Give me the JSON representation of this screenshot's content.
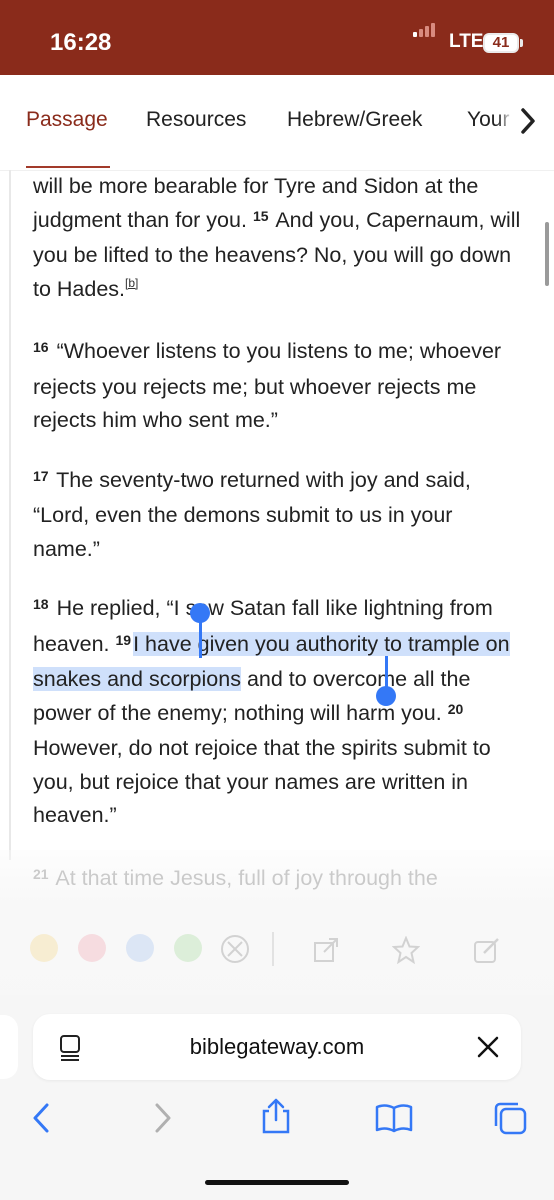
{
  "status": {
    "time": "16:28",
    "network": "LTE",
    "battery": "41"
  },
  "tabs": [
    {
      "label": "Passage",
      "active": true
    },
    {
      "label": "Resources"
    },
    {
      "label": "Hebrew/Greek"
    },
    {
      "label": "Your"
    }
  ],
  "passage": {
    "p1_text": "will be more bearable for Tyre and Sidon at the judgment than for you.",
    "v15": "15",
    "p1_text2": "And you, Capernaum, will you be lifted to the heavens? No, you will go down to Hades.",
    "fn_b": "[b]",
    "v16": "16",
    "p2_text": "“Whoever listens to you listens to me; whoever rejects you rejects me; but whoever rejects me rejects him who sent me.”",
    "v17": "17",
    "p3_text": "The seventy-two returned with joy and said, “Lord, even the demons submit to us in your name.”",
    "v18": "18",
    "p4_a": "He replied, “I saw Satan fall like lightning from heaven.",
    "v19": "19",
    "p4_sel": "I have given you authority to trample on snakes and scorpions",
    "p4_b": "and to overcome all the power of the enemy; nothing will harm you.",
    "v20": "20",
    "p4_c": "However, do not rejoice that the spirits submit to you, but rejoice that your names are written in heaven.”",
    "v21": "21",
    "p5_text": "At that time Jesus, full of joy through the"
  },
  "toolbar": {
    "highlight_colors": [
      "#f7d98b",
      "#f4a9b4",
      "#a9c6f2",
      "#a9dca0"
    ],
    "icons": [
      "clear-highlight-icon",
      "share-icon",
      "star-icon",
      "note-icon"
    ]
  },
  "browser": {
    "url": "biblegateway.com",
    "icons": [
      "reader-icon",
      "close-icon",
      "back-icon",
      "forward-icon",
      "share-icon",
      "bookmarks-icon",
      "tabs-icon"
    ]
  }
}
